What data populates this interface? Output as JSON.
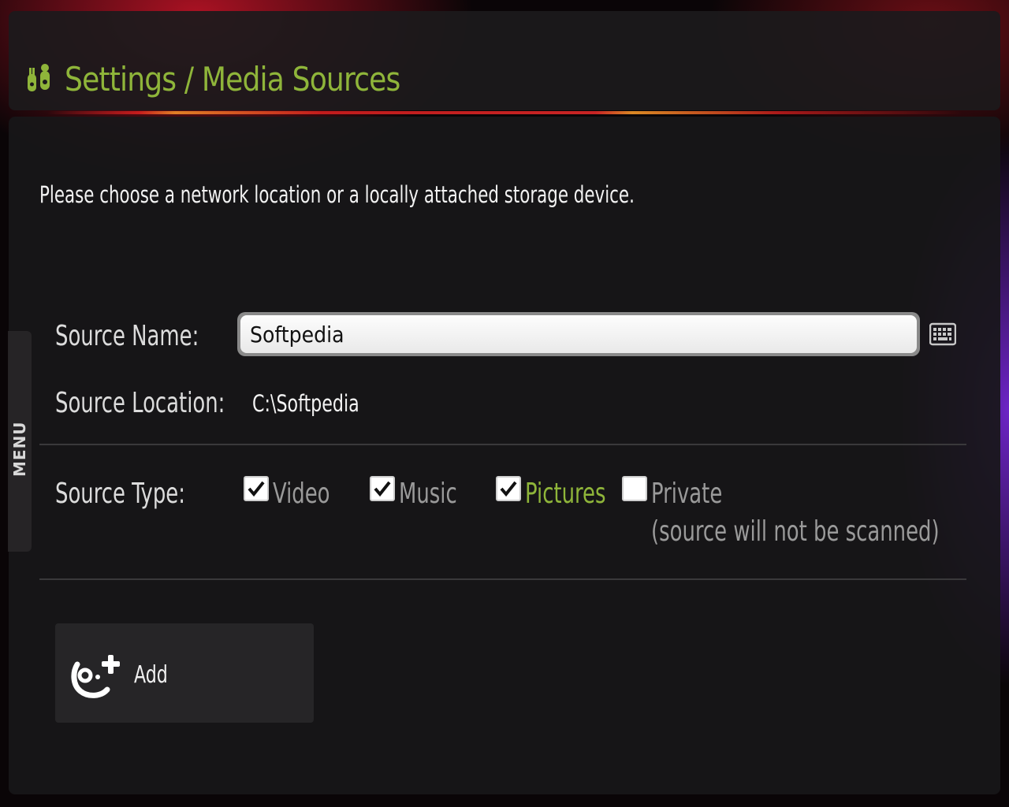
{
  "header": {
    "icon": "settings-plugs-icon",
    "title": "Settings / Media Sources"
  },
  "side_menu": {
    "label": "MENU"
  },
  "instruction": "Please choose a network location or a locally attached storage device.",
  "form": {
    "source_name": {
      "label": "Source Name:",
      "value": "Softpedia",
      "keyboard_icon": "keyboard-icon"
    },
    "source_location": {
      "label": "Source Location:",
      "value": "C:\\Softpedia"
    },
    "source_type": {
      "label": "Source Type:",
      "options": [
        {
          "label": "Video",
          "checked": true
        },
        {
          "label": "Music",
          "checked": true
        },
        {
          "label": "Pictures",
          "checked": true
        },
        {
          "label": "Private",
          "checked": false
        }
      ],
      "private_note": "(source will not be scanned)"
    }
  },
  "add_button": {
    "label": "Add",
    "icon": "add-source-icon"
  },
  "colors": {
    "accent_green": "#8fb53a",
    "text_light": "#dcdcdc",
    "muted_text": "#9a9a9a",
    "panel": "#1a191b"
  }
}
